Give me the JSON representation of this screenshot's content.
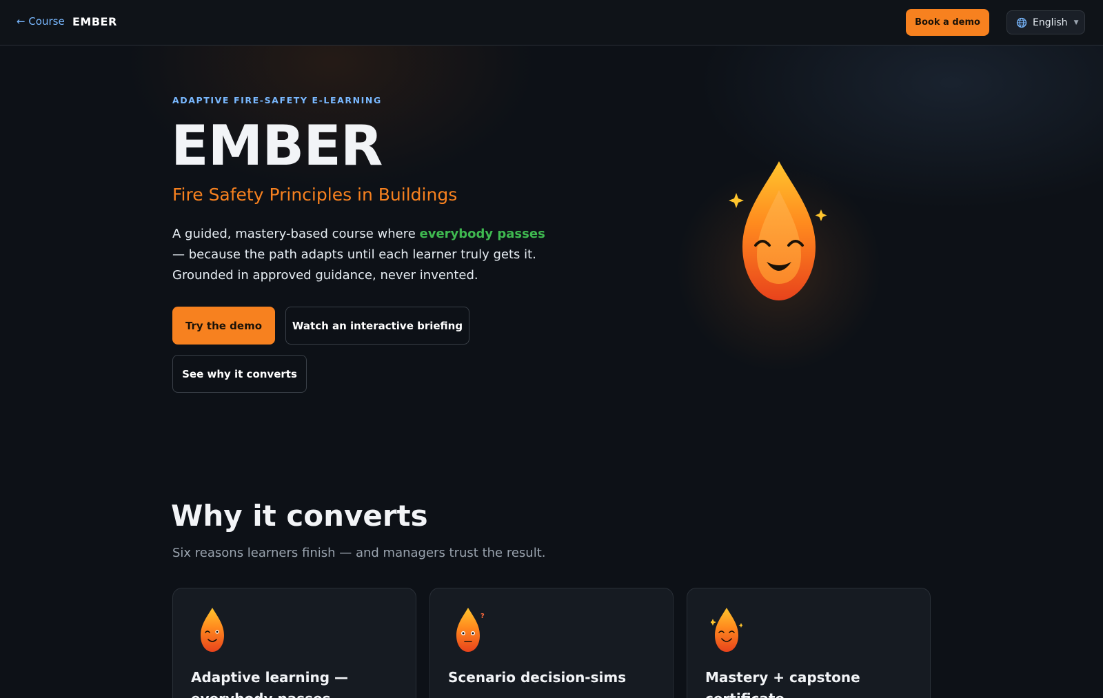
{
  "nav": {
    "back_label": "← Course",
    "brand": "EMBER",
    "book_label": "Book a demo",
    "language": "English"
  },
  "hero": {
    "eyebrow": "ADAPTIVE FIRE-SAFETY E-LEARNING",
    "title": "EMBER",
    "subtitle": "Fire Safety Principles in Buildings",
    "desc_before": "A guided, mastery-based course where ",
    "desc_highlight": "everybody passes",
    "desc_after": " — because the path adapts until each learner truly gets it. Grounded in approved guidance, never invented.",
    "buttons": {
      "try": "Try the demo",
      "watch": "Watch an interactive briefing",
      "why": "See why it converts"
    }
  },
  "section": {
    "title": "Why it converts",
    "subtitle": "Six reasons learners finish — and managers trust the result.",
    "cards": [
      {
        "title": "Adaptive learning — everybody passes",
        "icon": "winking-flame-icon"
      },
      {
        "title": "Scenario decision-sims",
        "icon": "curious-flame-icon"
      },
      {
        "title": "Mastery + capstone certificate",
        "icon": "sparkle-flame-icon"
      }
    ]
  },
  "colors": {
    "accent": "#f7811f",
    "link": "#79b8ff",
    "highlight": "#3fb950",
    "background": "#0d1117"
  }
}
